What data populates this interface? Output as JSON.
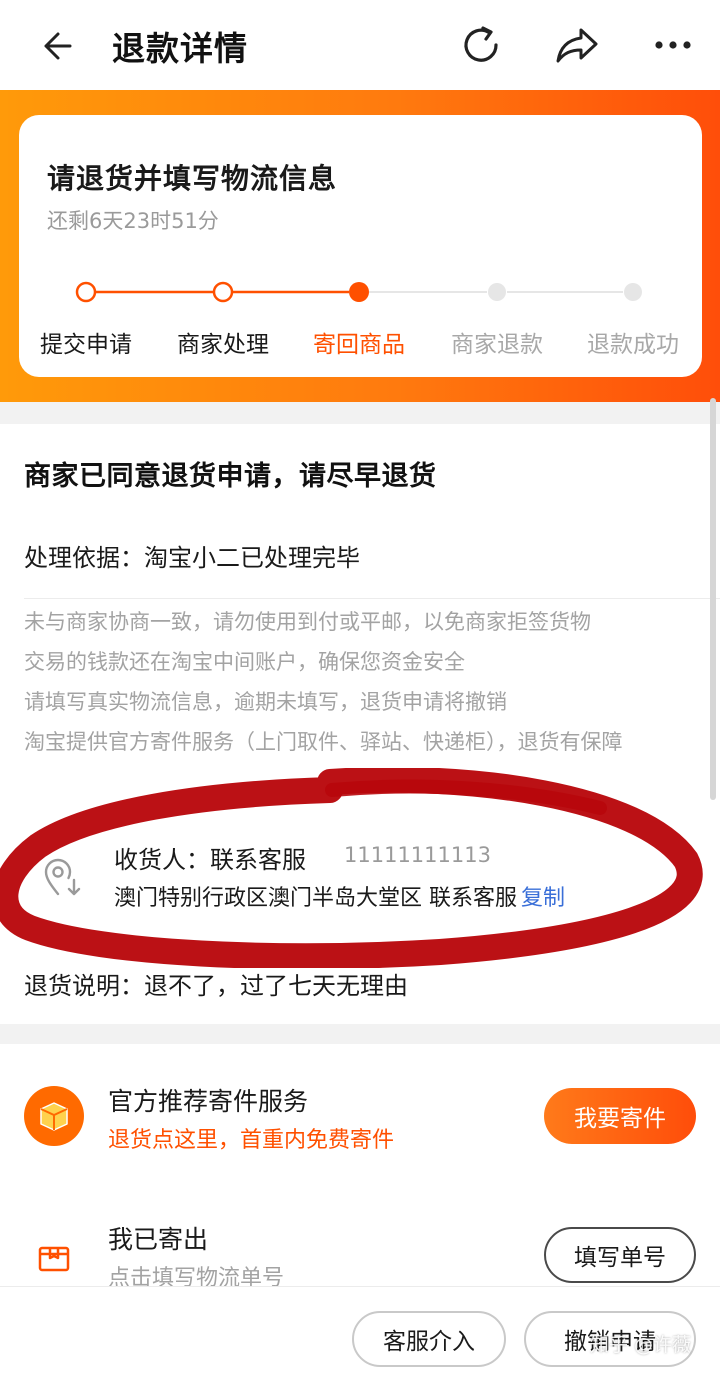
{
  "header": {
    "title": "退款详情",
    "icons": [
      "back-arrow-icon",
      "refresh-icon",
      "share-icon",
      "more-icon"
    ]
  },
  "status": {
    "title": "请退货并填写物流信息",
    "remaining": "还剩6天23时51分",
    "current_step": 3,
    "steps": [
      {
        "label": "提交申请",
        "state": "done"
      },
      {
        "label": "商家处理",
        "state": "done"
      },
      {
        "label": "寄回商品",
        "state": "active"
      },
      {
        "label": "商家退款",
        "state": "pending"
      },
      {
        "label": "退款成功",
        "state": "pending"
      }
    ]
  },
  "info": {
    "agree": "商家已同意退货申请，请尽早退货",
    "basis": "处理依据：淘宝小二已处理完毕",
    "notes": [
      "未与商家协商一致，请勿使用到付或平邮，以免商家拒签货物",
      "交易的钱款还在淘宝中间账户，确保您资金安全",
      "请填写真实物流信息，逾期未填写，退货申请将撤销",
      "淘宝提供官方寄件服务（上门取件、驿站、快递柜），退货有保障"
    ]
  },
  "address": {
    "recipient": "收货人：联系客服",
    "phone": "11111111113",
    "detail": "澳门特别行政区澳门半岛大堂区 联系客服",
    "copy": "复制",
    "return_note": "退货说明：退不了，过了七天无理由"
  },
  "shipping": {
    "official_title": "官方推荐寄件服务",
    "official_sub": "退货点这里，首重内免费寄件",
    "ship_button": "我要寄件",
    "sent_title": "我已寄出",
    "sent_sub": "点击填写物流单号",
    "fill_button": "填写单号"
  },
  "bottom": {
    "service_button": "客服介入",
    "cancel_button": "撤销申请"
  },
  "watermark": "知乎 @许薇",
  "colors": {
    "accent": "#ff5000",
    "banner_start": "#ff9a0a",
    "banner_end": "#ff4e0a",
    "link": "#3a6fd8",
    "annotation_red": "#b8070b"
  }
}
